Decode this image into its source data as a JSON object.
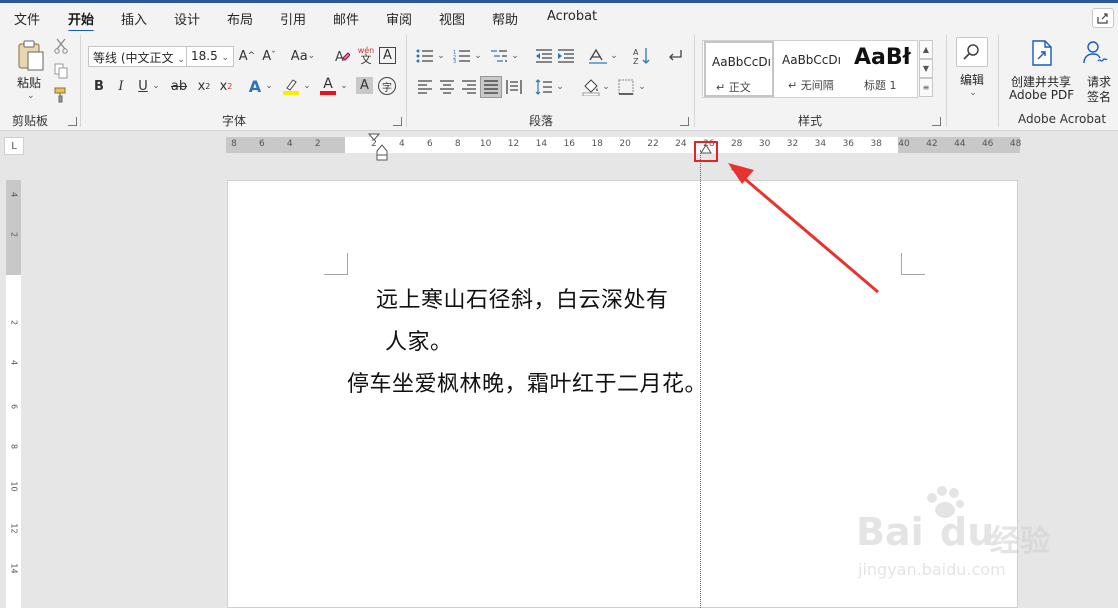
{
  "tabs": [
    "文件",
    "开始",
    "插入",
    "设计",
    "布局",
    "引用",
    "邮件",
    "审阅",
    "视图",
    "帮助",
    "Acrobat"
  ],
  "active_tab": "开始",
  "ribbon": {
    "clipboard": {
      "paste_label": "粘贴",
      "group_label": "剪贴板"
    },
    "font": {
      "font_name": "等线 (中文正文",
      "font_size": "18.5",
      "grow_font": "A",
      "shrink_font": "A",
      "change_case": "Aa",
      "bold": "B",
      "italic": "I",
      "underline": "U",
      "strikethrough": "ab",
      "subscript": "x",
      "superscript": "x",
      "text_effect": "A",
      "font_color": "A",
      "char_shade": "A",
      "phonetic_top": "wén",
      "phonetic_bottom": "文",
      "char_border": "A",
      "enclose_char": "字",
      "group_label": "字体"
    },
    "paragraph": {
      "group_label": "段落"
    },
    "styles": {
      "items": [
        {
          "preview": "AaBbCcDı",
          "name": "正文"
        },
        {
          "preview": "AaBbCcDı",
          "name": "无间隔"
        },
        {
          "preview": "AaBł",
          "name": "标题 1"
        }
      ],
      "group_label": "样式"
    },
    "editing": {
      "label": "编辑"
    },
    "acrobat": {
      "create_share_line1": "创建并共享",
      "create_share_line2": "Adobe PDF",
      "request_sign_line1": "请求",
      "request_sign_line2": "签名",
      "group_label": "Adobe Acrobat"
    },
    "colors": {
      "highlight": "#ffeb00",
      "font_color": "#e81123",
      "accent": "#185abd"
    }
  },
  "ruler": {
    "corner": "L",
    "left_ticks": [
      "8",
      "6",
      "4",
      "2"
    ],
    "main_ticks": [
      "2",
      "4",
      "6",
      "8",
      "10",
      "12",
      "14",
      "16",
      "18",
      "20",
      "22",
      "24",
      "26",
      "28",
      "30",
      "32",
      "34",
      "36",
      "38"
    ],
    "right_ticks": [
      "40",
      "42",
      "44",
      "46",
      "48"
    ],
    "vertical_ticks": [
      "4",
      "2",
      "2",
      "4",
      "6",
      "8",
      "10",
      "12",
      "14"
    ]
  },
  "document": {
    "lines": [
      "远上寒山石径斜，白云深处有",
      "人家。",
      "停车坐爱枫林晚，霜叶红于二月花。"
    ]
  },
  "watermark": {
    "brand": "Bai",
    "brand2": "du",
    "suffix": "经验",
    "url": "jingyan.baidu.com"
  }
}
